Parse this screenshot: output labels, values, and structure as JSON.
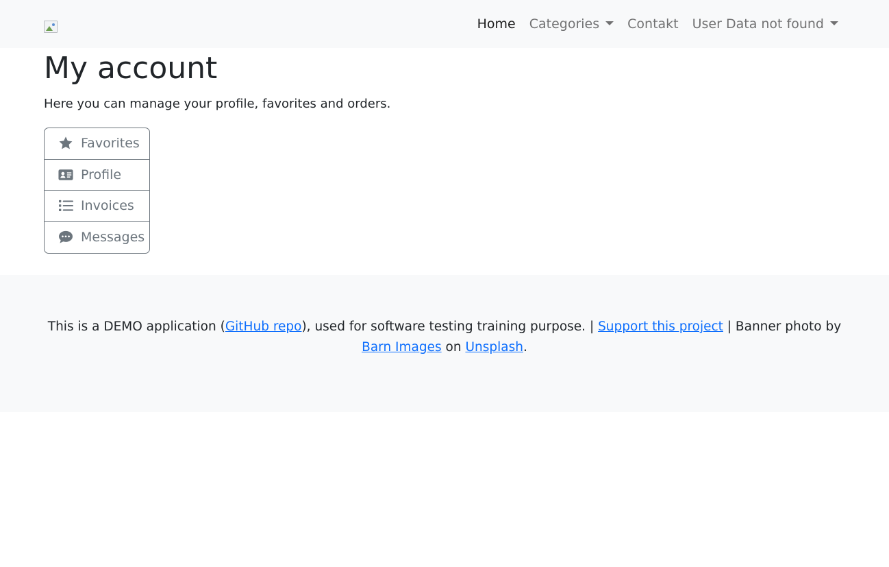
{
  "navbar": {
    "logo_icon": "broken-image-icon",
    "links": [
      {
        "label": "Home",
        "active": true
      },
      {
        "label": "Categories",
        "dropdown": true
      },
      {
        "label": "Contakt"
      },
      {
        "label": "User Data not found",
        "dropdown": true
      }
    ]
  },
  "main": {
    "title": "My account",
    "intro": "Here you can manage your profile, favorites and orders.",
    "menu": [
      {
        "label": "Favorites",
        "icon": "star-icon"
      },
      {
        "label": "Profile",
        "icon": "id-card-icon"
      },
      {
        "label": "Invoices",
        "icon": "list-icon"
      },
      {
        "label": "Messages",
        "icon": "chat-bubble-icon"
      }
    ]
  },
  "footer": {
    "text_1": "This is a DEMO application (",
    "github_link": "GitHub repo",
    "text_2": "), used for software testing training purpose. | ",
    "support_link": "Support this project",
    "text_3": " | Banner photo by ",
    "barn_link": "Barn Images",
    "text_4": " on ",
    "unsplash_link": "Unsplash",
    "text_5": "."
  },
  "colors": {
    "navbar_bg": "#f8f9fa",
    "link": "#0d6efd",
    "muted": "#6c757d",
    "text": "#212529"
  }
}
